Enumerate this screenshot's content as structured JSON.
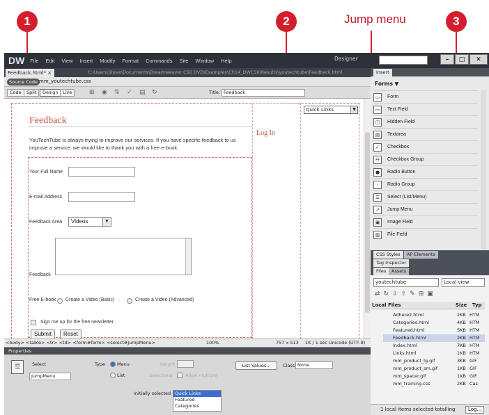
{
  "callouts": {
    "one": "1",
    "two": "2",
    "three": "3",
    "jump_label": "Jump menu"
  },
  "app": {
    "logo": "DW",
    "menus": [
      "File",
      "Edit",
      "View",
      "Insert",
      "Modify",
      "Format",
      "Commands",
      "Site",
      "Window",
      "Help"
    ],
    "workspace": "Designer",
    "doc_tab": "Feedback.html* ×",
    "doc_path": "C:\\Users\\Steve\\Documents\\Dreamweaver CS6 DVD\\Examples\\Ch14_DWCS6\\Results\\youtechtube\\Feedback.html",
    "source_code": "Source Code",
    "css_file": "mm_youtechtube.css",
    "toolbar": {
      "code": "Code",
      "split": "Split",
      "design": "Design",
      "live": "Live",
      "title_label": "Title:",
      "title_value": "Feedback"
    }
  },
  "page": {
    "heading": "Feedback",
    "intro": "YouTechTube is always trying to improve our services. If you have specific feedback to us improve a service, we would like to thank you with a free e-book.",
    "login": "Log In",
    "quick_links": "Quick Links",
    "full_name": "Your Full Name",
    "email": "E-mail Address",
    "feedback_area": "Feedback Area",
    "feedback_area_value": "Videos",
    "feedback": "Feedback",
    "free_ebook": "Free E-book",
    "radio_basic": "Create a Video (Basic)",
    "radio_advanced": "Create a Video (Advanced)",
    "newsletter": "Sign me up for the free newsletter",
    "submit": "Submit",
    "reset": "Reset"
  },
  "statusbar": {
    "tags": "<body> <table> <tr> <td> <form#form> <select#JumpMenu>",
    "zoom": "100%",
    "size": "757 x 513",
    "info": "1K / 1 sec  Unicode (UTF-8)"
  },
  "properties": {
    "header": "Properties",
    "select_label": "Select",
    "name_value": "JumpMenu",
    "type_label": "Type",
    "type_menu": "Menu",
    "type_list": "List",
    "height": "Height",
    "selections": "Selections",
    "allow_multiple": "Allow multiple",
    "list_values": "List Values...",
    "class_label": "Class",
    "class_value": "None",
    "initially_selected": "Initially selected",
    "options": [
      "Quick Links",
      "Featured",
      "Categories"
    ]
  },
  "insert_panel": {
    "tab": "Insert",
    "category": "Forms ▼",
    "items": [
      "Form",
      "Text Field",
      "Hidden Field",
      "Textarea",
      "Checkbox",
      "Checkbox Group",
      "Radio Button",
      "Radio Group",
      "Select (List/Menu)",
      "Jump Menu",
      "Image Field",
      "File Field"
    ]
  },
  "panels": {
    "css_styles": "CSS Styles",
    "ap_elements": "AP Elements",
    "tag_inspector": "Tag Inspector",
    "files": "Files",
    "assets": "Assets",
    "site": "youtechtube",
    "view": "Local view",
    "local_files": "Local Files",
    "size": "Size",
    "type": "Typ",
    "files_list": [
      {
        "name": "Adhere2.html",
        "size": "2KB",
        "type": "HTM"
      },
      {
        "name": "Categories.html",
        "size": "4KB",
        "type": "HTM"
      },
      {
        "name": "Featured.html",
        "size": "5KB",
        "type": "HTM"
      },
      {
        "name": "Feedback.html",
        "size": "2KB",
        "type": "HTM"
      },
      {
        "name": "Index.html",
        "size": "7KB",
        "type": "HTM"
      },
      {
        "name": "Links.html",
        "size": "1KB",
        "type": "HTM"
      },
      {
        "name": "mm_product_lg.gif",
        "size": "3KB",
        "type": "GIF"
      },
      {
        "name": "mm_product_sm.gif",
        "size": "1KB",
        "type": "GIF"
      },
      {
        "name": "mm_spacer.gif",
        "size": "1KB",
        "type": "GIF"
      },
      {
        "name": "mm_training.css",
        "size": "2KB",
        "type": "Cas"
      }
    ],
    "status": "1 local items selected totalling",
    "log": "Log..."
  }
}
